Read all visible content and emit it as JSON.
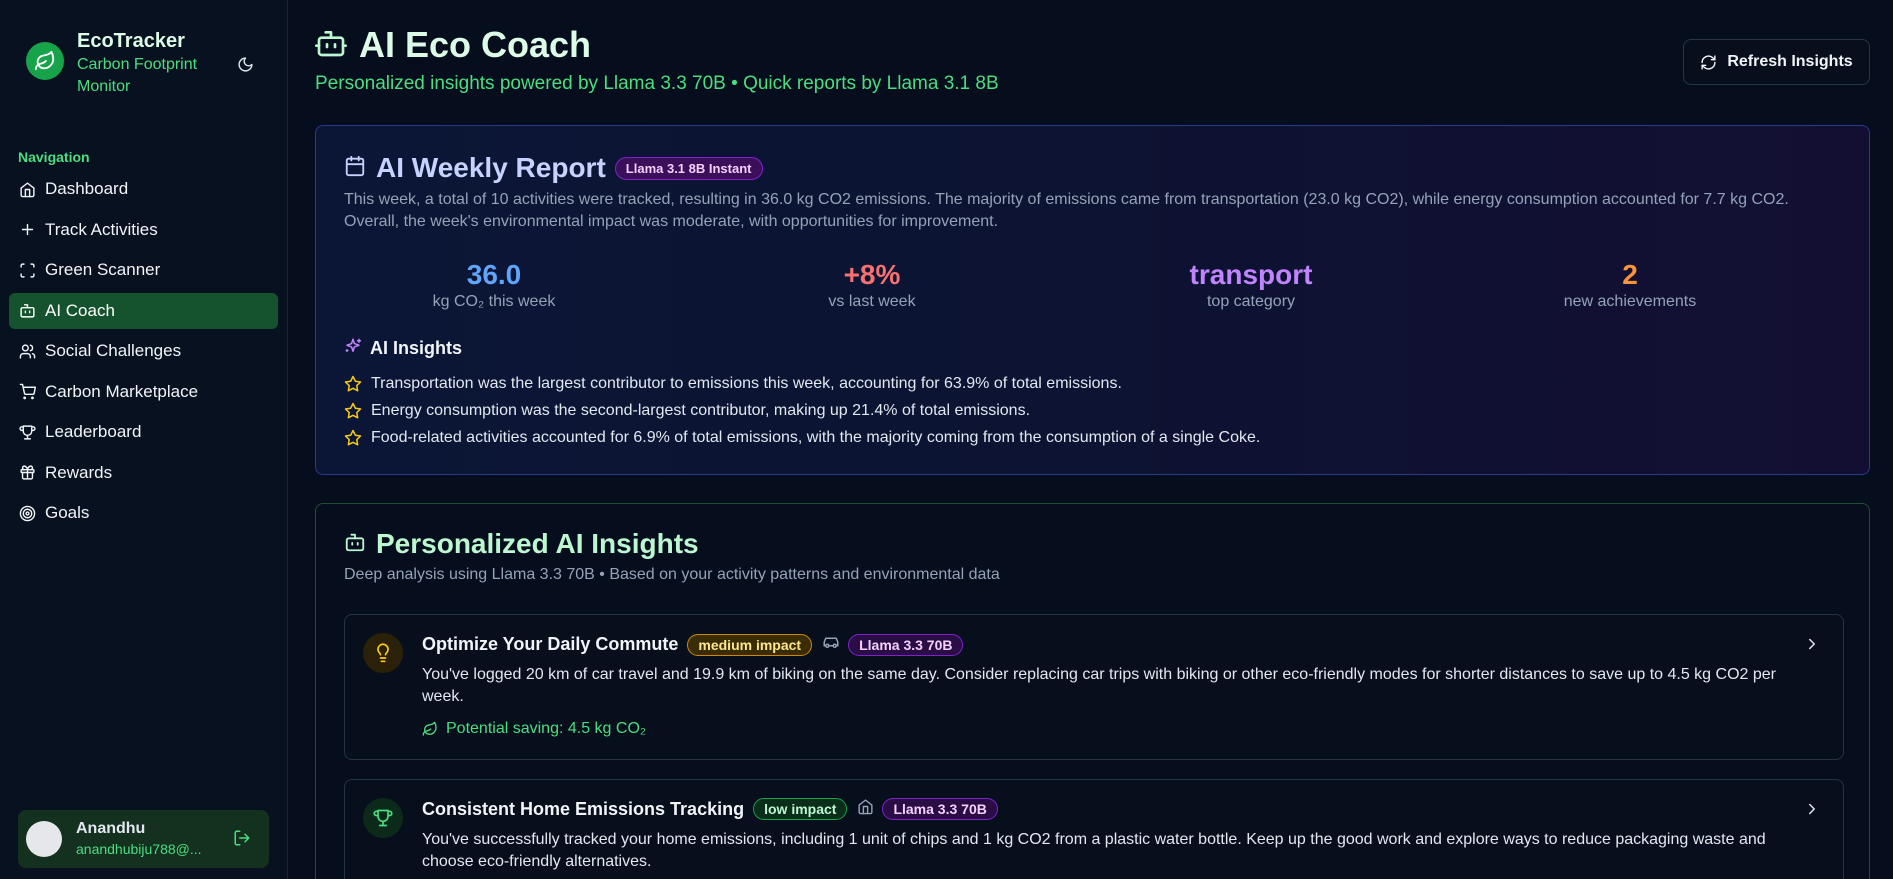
{
  "brand": {
    "title": "EcoTracker",
    "subtitle": "Carbon Footprint Monitor",
    "icon": "leaf-icon"
  },
  "sidebar": {
    "heading": "Navigation",
    "items": [
      {
        "label": "Dashboard",
        "icon": "home-icon"
      },
      {
        "label": "Track Activities",
        "icon": "plus-icon"
      },
      {
        "label": "Green Scanner",
        "icon": "scan-icon"
      },
      {
        "label": "AI Coach",
        "icon": "bot-icon",
        "active": true
      },
      {
        "label": "Social Challenges",
        "icon": "users-icon"
      },
      {
        "label": "Carbon Marketplace",
        "icon": "cart-icon"
      },
      {
        "label": "Leaderboard",
        "icon": "trophy-icon"
      },
      {
        "label": "Rewards",
        "icon": "gift-icon"
      },
      {
        "label": "Goals",
        "icon": "target-icon"
      }
    ]
  },
  "user": {
    "name": "Anandhu",
    "email": "anandhubiju788@..."
  },
  "header": {
    "title": "AI Eco Coach",
    "subtitle": "Personalized insights powered by Llama 3.3 70B • Quick reports by Llama 3.1 8B",
    "refresh_label": "Refresh Insights"
  },
  "weekly_report": {
    "title": "AI Weekly Report",
    "badge": "Llama 3.1 8B Instant",
    "summary": "This week, a total of 10 activities were tracked, resulting in 36.0 kg CO2 emissions. The majority of emissions came from transportation (23.0 kg CO2), while energy consumption accounted for 7.7 kg CO2. Overall, the week's environmental impact was moderate, with opportunities for improvement.",
    "stats": [
      {
        "value": "36.0",
        "label": "kg CO₂ this week",
        "color": "#60a5fa"
      },
      {
        "value": "+8%",
        "label": "vs last week",
        "color": "#f87171"
      },
      {
        "value": "transport",
        "label": "top category",
        "color": "#c084fc"
      },
      {
        "value": "2",
        "label": "new achievements",
        "color": "#fb923c"
      }
    ],
    "insights_title": "AI Insights",
    "insights": [
      "Transportation was the largest contributor to emissions this week, accounting for 63.9% of total emissions.",
      "Energy consumption was the second-largest contributor, making up 21.4% of total emissions.",
      "Food-related activities accounted for 6.9% of total emissions, with the majority coming from the consumption of a single Coke."
    ]
  },
  "personalized": {
    "title": "Personalized AI Insights",
    "subtitle": "Deep analysis using Llama 3.3 70B • Based on your activity patterns and environmental data",
    "recommendations": [
      {
        "title": "Optimize Your Daily Commute",
        "impact": "medium impact",
        "model": "Llama 3.3 70B",
        "icon": "lightbulb-icon",
        "category_icon": "car-icon",
        "description": "You've logged 20 km of car travel and 19.9 km of biking on the same day. Consider replacing car trips with biking or other eco-friendly modes for shorter distances to save up to 4.5 kg CO2 per week.",
        "saving": "Potential saving: 4.5 kg CO₂"
      },
      {
        "title": "Consistent Home Emissions Tracking",
        "impact": "low impact",
        "model": "Llama 3.3 70B",
        "icon": "trophy-icon",
        "category_icon": "home-icon",
        "description": "You've successfully tracked your home emissions, including 1 unit of chips and 1 kg CO2 from a plastic water bottle. Keep up the good work and explore ways to reduce packaging waste and choose eco-friendly alternatives."
      }
    ]
  }
}
